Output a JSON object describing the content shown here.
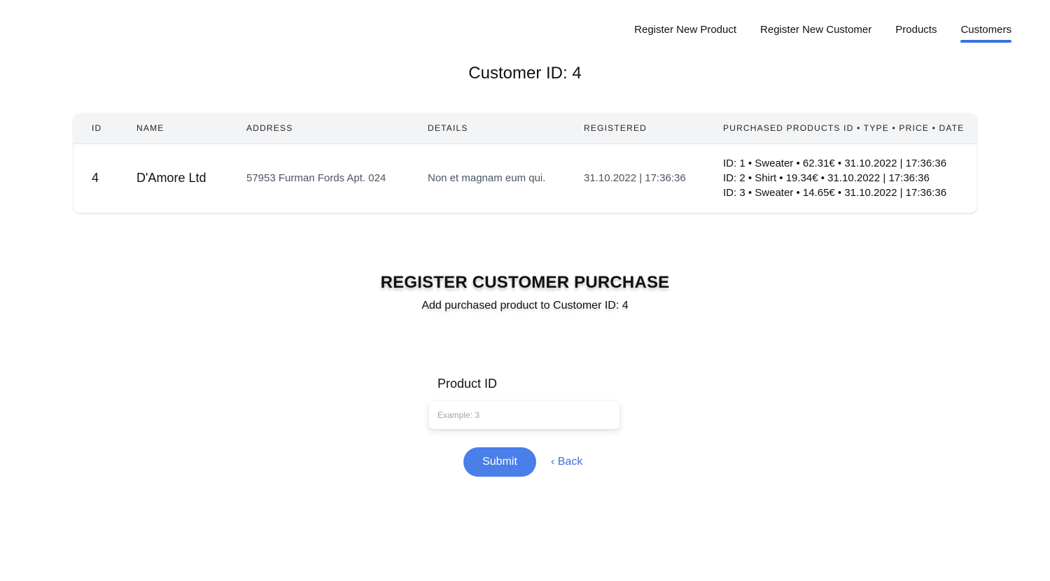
{
  "nav": {
    "items": [
      {
        "label": "Register New Product",
        "active": false
      },
      {
        "label": "Register New Customer",
        "active": false
      },
      {
        "label": "Products",
        "active": false
      },
      {
        "label": "Customers",
        "active": true
      }
    ],
    "accent_color": "#3b6fe0"
  },
  "page": {
    "title": "Customer ID: 4"
  },
  "table": {
    "headers": [
      "ID",
      "NAME",
      "ADDRESS",
      "DETAILS",
      "REGISTERED",
      "PURCHASED PRODUCTS ID • TYPE • PRICE • DATE"
    ],
    "row": {
      "id": "4",
      "name": "D'Amore Ltd",
      "address": "57953 Furman Fords Apt. 024",
      "details": "Non et magnam eum qui.",
      "registered": "31.10.2022 | 17:36:36",
      "purchases": [
        "ID: 1 • Sweater • 62.31€ • 31.10.2022 | 17:36:36",
        "ID: 2 • Shirt • 19.34€ • 31.10.2022 | 17:36:36",
        "ID: 3 • Sweater • 14.65€ • 31.10.2022 | 17:36:36"
      ]
    }
  },
  "register": {
    "title": "REGISTER CUSTOMER PURCHASE",
    "subtitle": "Add purchased product to Customer ID: 4",
    "field_label": "Product ID",
    "field_placeholder": "Example: 3",
    "field_value": "",
    "submit_label": "Submit",
    "back_label": "‹ Back",
    "button_color": "#4a7ee8"
  }
}
